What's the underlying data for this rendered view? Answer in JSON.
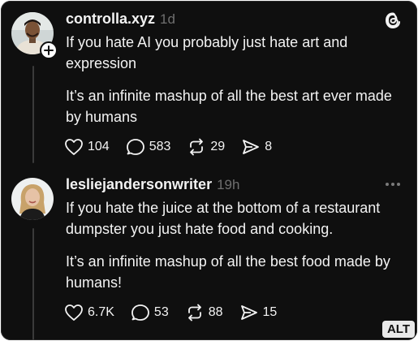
{
  "posts": [
    {
      "username": "controlla.xyz",
      "time": "1d",
      "paragraphs": [
        "If you hate AI you probably just hate art and expression",
        "It’s an infinite mashup of all the best art ever made by humans"
      ],
      "likes": "104",
      "replies": "583",
      "reposts": "29",
      "shares": "8",
      "icons": [
        "heart-icon",
        "comment-icon",
        "repost-icon",
        "share-icon",
        "plus-icon",
        "threads-logo-icon"
      ]
    },
    {
      "username": "lesliejandersonwriter",
      "time": "19h",
      "paragraphs": [
        "If you hate the juice at the bottom of a restaurant dumpster you just hate food and cooking.",
        "It’s an infinite mashup of all the best food made by humans!"
      ],
      "likes": "6.7K",
      "replies": "53",
      "reposts": "88",
      "shares": "15",
      "icons": [
        "heart-icon",
        "comment-icon",
        "repost-icon",
        "share-icon",
        "more-icon"
      ]
    }
  ],
  "alt_badge": "ALT",
  "colors": {
    "background": "#0f0f0f",
    "text": "#f3f3f3",
    "muted": "#6f6f6f",
    "thread_line": "#3a3a3a"
  }
}
